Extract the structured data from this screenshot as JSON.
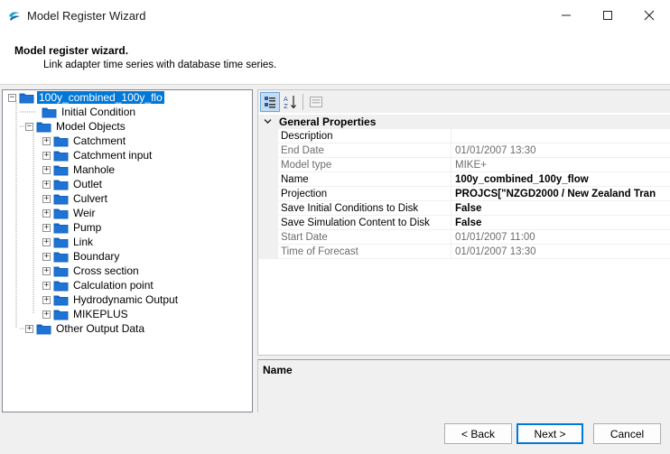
{
  "window": {
    "title": "Model Register Wizard"
  },
  "header": {
    "title": "Model register wizard.",
    "subtitle": "Link adapter time series with database time series."
  },
  "tree": {
    "root": "100y_combined_100y_flo",
    "initial_condition": "Initial Condition",
    "model_objects": "Model Objects",
    "children": [
      "Catchment",
      "Catchment input",
      "Manhole",
      "Outlet",
      "Culvert",
      "Weir",
      "Pump",
      "Link",
      "Boundary",
      "Cross section",
      "Calculation point",
      "Hydrodynamic Output",
      "MIKEPLUS"
    ],
    "other_output": "Other Output Data"
  },
  "properties": {
    "category": "General Properties",
    "rows": [
      {
        "name": "Description",
        "value": ""
      },
      {
        "name": "End Date",
        "value": "01/01/2007 13:30"
      },
      {
        "name": "Model type",
        "value": "MIKE+"
      },
      {
        "name": "Name",
        "value": "100y_combined_100y_flow"
      },
      {
        "name": "Projection",
        "value": "PROJCS[\"NZGD2000 / New Zealand Tran"
      },
      {
        "name": "Save Initial Conditions to Disk",
        "value": "False"
      },
      {
        "name": "Save Simulation Content to Disk",
        "value": "False"
      },
      {
        "name": "Start Date",
        "value": "01/01/2007 11:00"
      },
      {
        "name": "Time of Forecast",
        "value": "01/01/2007 13:30"
      }
    ]
  },
  "description_panel": {
    "title": "Name"
  },
  "buttons": {
    "back": "< Back",
    "next": "Next >",
    "cancel": "Cancel"
  },
  "colors": {
    "selection": "#0078d7",
    "folder": "#1565c0"
  }
}
